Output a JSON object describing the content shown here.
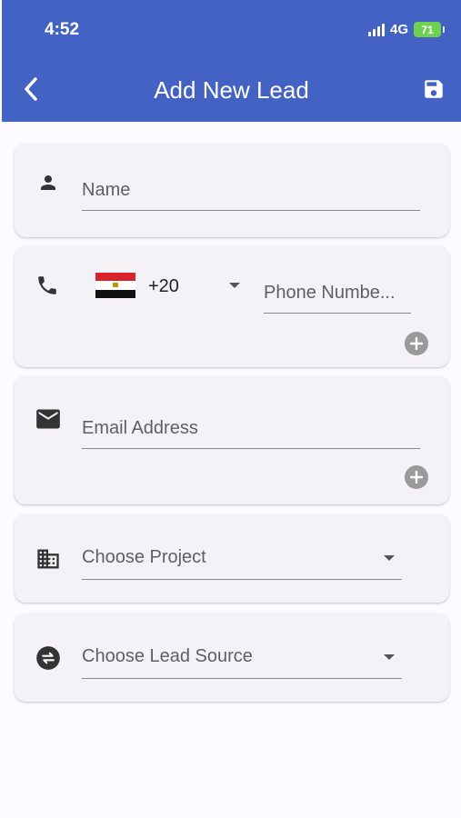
{
  "status": {
    "time": "4:52",
    "network": "4G",
    "battery": "71"
  },
  "header": {
    "title": "Add New Lead"
  },
  "form": {
    "name_placeholder": "Name",
    "phone": {
      "country_code": "+20",
      "placeholder": "Phone Numbe..."
    },
    "email_placeholder": "Email Address",
    "project_label": "Choose Project",
    "lead_source_label": "Choose Lead Source"
  },
  "icons": {
    "back": "chevron-left-icon",
    "save": "floppy-disk-icon",
    "name": "person-icon",
    "phone": "phone-icon",
    "email": "envelope-icon",
    "project": "building-icon",
    "lead_source": "swap-circle-icon",
    "add": "plus-circle-icon"
  },
  "colors": {
    "appbar": "#4362c4",
    "background": "#fdfbff",
    "card": "#f4f2f7",
    "battery": "#6fcf4f"
  }
}
